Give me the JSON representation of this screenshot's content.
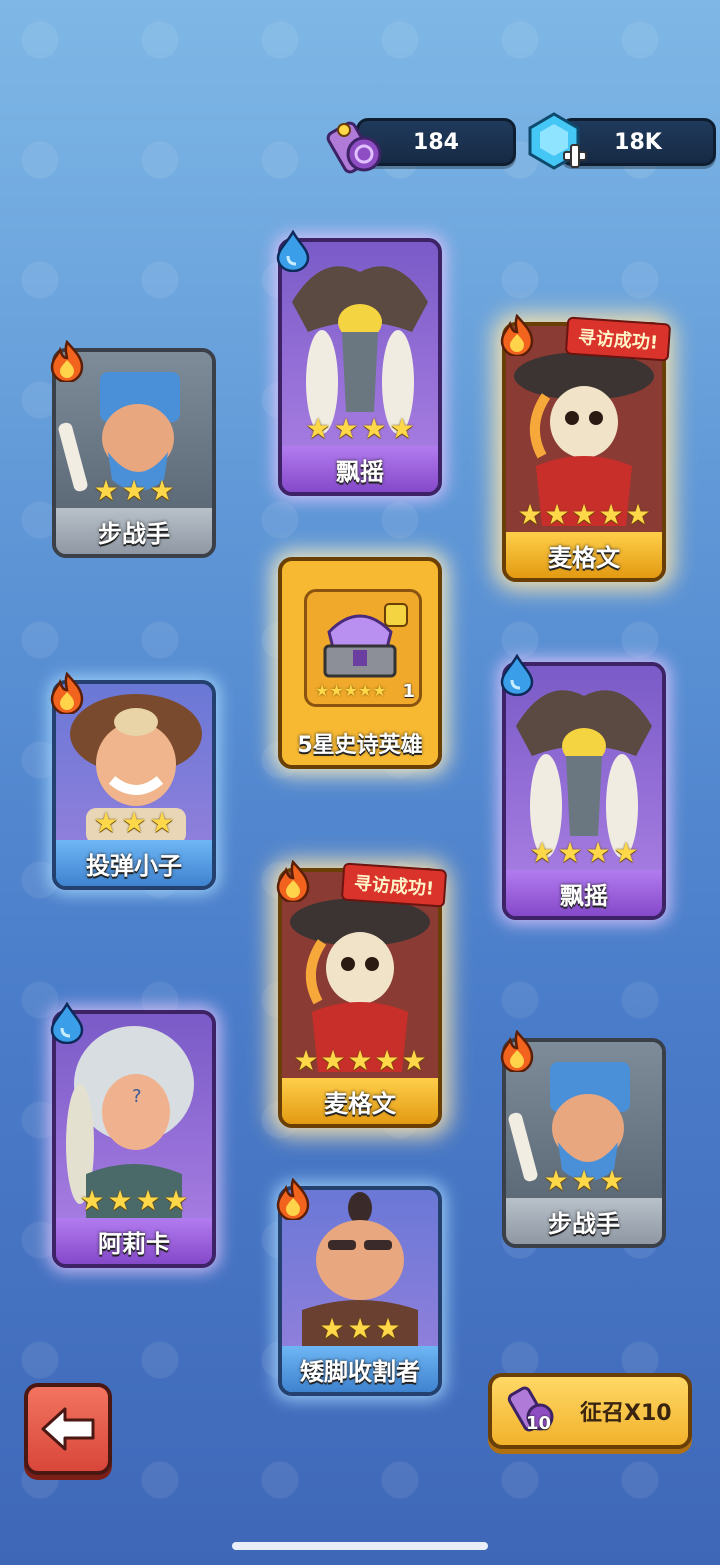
{
  "currency": {
    "scrolls": "184",
    "gems": "18K"
  },
  "cards": [
    {
      "id": "c1",
      "name": "步战手",
      "stars": 3,
      "rarity": "gray",
      "element": "fire"
    },
    {
      "id": "c2",
      "name": "飘摇",
      "stars": 4,
      "rarity": "purple",
      "element": "water"
    },
    {
      "id": "c3",
      "name": "麦格文",
      "stars": 5,
      "rarity": "gold",
      "element": "fire",
      "ribbon": "寻访成功!"
    },
    {
      "id": "c4",
      "name": "投弹小子",
      "stars": 3,
      "rarity": "blue",
      "element": "fire"
    },
    {
      "id": "c5",
      "name": "飘摇",
      "stars": 4,
      "rarity": "purple",
      "element": "water"
    },
    {
      "id": "c6",
      "name": "麦格文",
      "stars": 5,
      "rarity": "gold",
      "element": "fire",
      "ribbon": "寻访成功!"
    },
    {
      "id": "c7",
      "name": "阿莉卡",
      "stars": 4,
      "rarity": "purple",
      "element": "water"
    },
    {
      "id": "c8",
      "name": "步战手",
      "stars": 3,
      "rarity": "gray",
      "element": "fire"
    },
    {
      "id": "c9",
      "name": "矮脚收割者",
      "stars": 3,
      "rarity": "blue",
      "element": "fire"
    }
  ],
  "chest": {
    "name": "5星史诗英雄",
    "count": "1"
  },
  "buttons": {
    "summon_label": "征召X10",
    "summon_cost": "10"
  },
  "colors": {
    "gold": "#f5b82a",
    "purple": "#a36be0",
    "blue": "#5aa0e8",
    "gray": "#9aa3ad",
    "back_button": "#e0533f"
  }
}
